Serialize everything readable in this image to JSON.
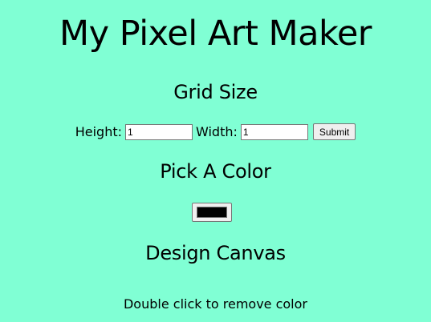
{
  "app": {
    "title": "My Pixel Art Maker"
  },
  "grid_size": {
    "heading": "Grid Size",
    "height_label": "Height:",
    "height_value": "1",
    "width_label": "Width:",
    "width_value": "1",
    "submit_label": "Submit"
  },
  "color": {
    "heading": "Pick A Color",
    "selected_color": "#000000"
  },
  "canvas": {
    "heading": "Design Canvas",
    "hint": "Double click to remove color"
  },
  "theme": {
    "background": "#80ffd4"
  }
}
